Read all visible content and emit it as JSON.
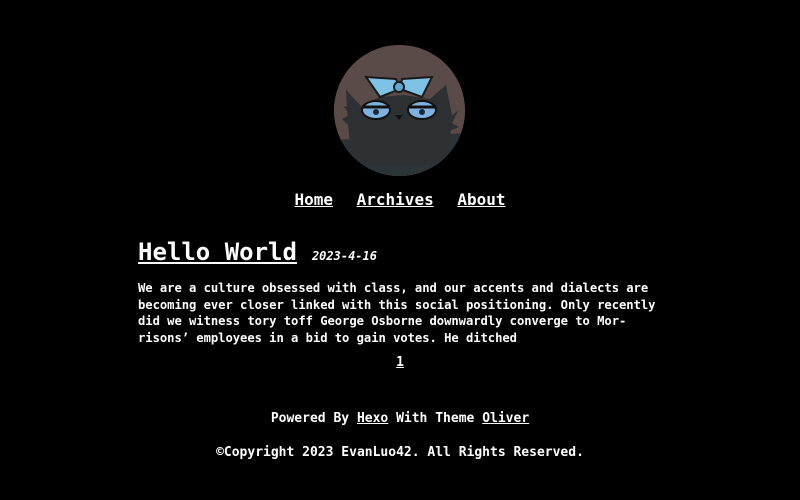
{
  "avatar": {
    "icon": "cat-avatar-icon",
    "colors": {
      "bg": "#5a4a48",
      "fur": "#2e3134",
      "eyes": "#7fb2e0",
      "bow": "#7ec3e6"
    }
  },
  "nav": {
    "items": [
      {
        "label": "Home"
      },
      {
        "label": "Archives"
      },
      {
        "label": "About"
      }
    ]
  },
  "post": {
    "title": "Hello World",
    "date": "2023-4-16",
    "excerpt_lines": [
      "We are a culture obsessed with class, and our accents and dialects are",
      "becoming ever closer linked with this social positioning. Only recently",
      "did we witness tory toff George Osborne downwardly converge to Mor-",
      "risons’ employees in a bid to gain votes. He ditched"
    ]
  },
  "pagination": {
    "current": "1"
  },
  "footer": {
    "powered_prefix": "Powered By",
    "hexo_link": "Hexo",
    "theme_text": "With Theme",
    "theme_link": "Oliver",
    "copyright": "©Copyright 2023 EvanLuo42. All Rights Reserved."
  }
}
